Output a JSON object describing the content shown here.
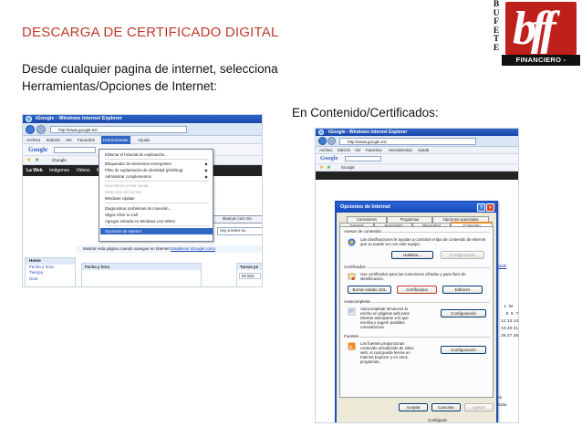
{
  "slide": {
    "title": "DESCARGA DE CERTIFICADO DIGITAL",
    "intro_line1": "Desde cualquier pagina de internet, selecciona",
    "intro_line2": "Herramientas/Opciones de Internet:",
    "caption_right": "En Contenido/Certificados:"
  },
  "logo": {
    "letters": [
      "B",
      "U",
      "F",
      "E",
      "T",
      "E"
    ],
    "mark": "bff",
    "footer": "FINANCIERO - FISCAL",
    "colors": {
      "box": "#c0201c",
      "footer": "#111111"
    }
  },
  "screenshot1": {
    "window_title": "iGoogle - Windows Internet Explorer",
    "address": "http://www.google.es/",
    "menu": [
      "Archivo",
      "Edición",
      "Ver",
      "Favoritos",
      "Herramientas",
      "Ayuda"
    ],
    "google_logo": "Google",
    "favorite": "iGoogle",
    "google_nav": [
      "La Web",
      "Imágenes",
      "Videos",
      "M"
    ],
    "dropdown": [
      "Eliminar el historial de exploración...",
      "Bloqueador de elementos emergentes",
      "Filtro de suplantación de identidad (phishing)",
      "Administrar complementos",
      "Suscribirse a esta fuente...",
      "Detección de fuentes",
      "Windows Update",
      "Diagnosticar problemas de conexión...",
      "Skype Click to Call",
      "Agregar entrada en Windows Live Writer",
      "Opciones de Internet"
    ],
    "search_button": "Buscar con Go",
    "search_button_tail": "Voy a tener su",
    "notice_text": "Mostrar esta página cuando navegue en Internet",
    "notice_link": "Establecer iGoogle como",
    "side_panel": [
      "Home",
      "Fecha y hora",
      "Tiempo",
      "Ocio"
    ],
    "gadget_headers": [
      "Fecha y hora",
      "Tarea",
      "Tareas pe"
    ],
    "gadget_item": "Mi lista"
  },
  "screenshot2": {
    "window_title": "iGoogle - Windows Internet Explorer",
    "address": "http://www.google.es/",
    "menu": [
      "Archivo",
      "Edición",
      "Ver",
      "Favoritos",
      "Herramientas",
      "Ayuda"
    ],
    "google_logo": "Google",
    "favorite": "iGoogle",
    "right_side": [
      "Establ",
      "L",
      "M",
      "5",
      "6",
      "7",
      "12",
      "13",
      "14",
      "19",
      "20",
      "21",
      "26",
      "27",
      "28",
      "l",
      "r es",
      "e todo"
    ],
    "dialog": {
      "title": "Opciones de Internet",
      "tabs_row1": [
        "Conexiones",
        "Programas",
        "Opciones avanzadas"
      ],
      "tabs_row2": [
        "General",
        "Seguridad",
        "Privacidad",
        "Contenido"
      ],
      "asesor": {
        "label": "Asesor de contenido",
        "text": "Las clasificaciones le ayudan a controlar el tipo de contenido de Internet que se puede ver con este equipo.",
        "btn_enable": "Habilitar...",
        "btn_config": "Configuración"
      },
      "certificados": {
        "label": "Certificados",
        "text": "Use certificados para las conexiones cifradas y para fines de identificación.",
        "btn_clear": "Borrar estado SSL",
        "btn_certs": "Certificados",
        "btn_editors": "Editores"
      },
      "autocompletar": {
        "label": "Autocompletar",
        "text": "Autocompletar almacena lo escrito en páginas web para intentar anticiparse a lo que escriba y sugerir posibles coincidencias.",
        "btn": "Configuración"
      },
      "fuentes": {
        "label": "Fuentes",
        "text": "Las fuentes proporcionan contenido actualizado de sitios web, el cual puede leerse en Internet Explorer y en otros programas.",
        "btn": "Configuración"
      },
      "btn_ok": "Aceptar",
      "btn_cancel": "Cancelar",
      "btn_apply": "Aplicar",
      "bottom_peek": "Configurar"
    }
  }
}
